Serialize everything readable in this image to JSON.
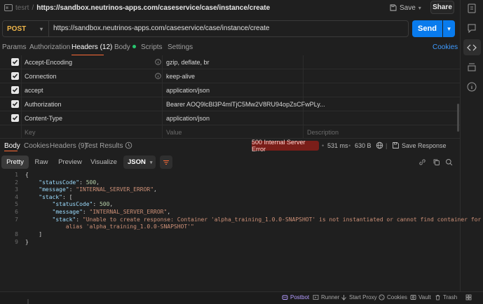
{
  "titlebar": {
    "request_name": "tesrt",
    "separator": "/",
    "url": "https://sandbox.neutrinos-apps.com/caseservice/case/instance/create",
    "save_label": "Save",
    "share_label": "Share"
  },
  "request": {
    "method": "POST",
    "url": "https://sandbox.neutrinos-apps.com/caseservice/case/instance/create",
    "send_label": "Send"
  },
  "request_tabs": {
    "params": "Params",
    "authorization": "Authorization",
    "headers": "Headers (12)",
    "body": "Body",
    "scripts": "Scripts",
    "settings": "Settings",
    "cookies": "Cookies"
  },
  "headers": {
    "rows": [
      {
        "key": "Accept-Encoding",
        "value": "gzip, deflate, br"
      },
      {
        "key": "Connection",
        "value": "keep-alive"
      },
      {
        "key": "accept",
        "value": "application/json"
      },
      {
        "key": "Authorization",
        "value": "Bearer AOQ9lcBl3P4mlTjC5Mw2V8RU94opZsCFwPLy..."
      },
      {
        "key": "Content-Type",
        "value": "application/json"
      }
    ],
    "placeholder_key": "Key",
    "placeholder_value": "Value",
    "placeholder_description": "Description"
  },
  "response_tabs": {
    "body": "Body",
    "cookies": "Cookies",
    "headers": "Headers (9)",
    "test_results": "Test Results"
  },
  "response_meta": {
    "status": "500 Internal Server Error",
    "time": "531 ms",
    "size": "630 B",
    "save_response": "Save Response"
  },
  "view": {
    "pretty": "Pretty",
    "raw": "Raw",
    "preview": "Preview",
    "visualize": "Visualize",
    "format": "JSON"
  },
  "code": {
    "line_numbers": [
      "1",
      "2",
      "3",
      "4",
      "5",
      "6",
      "7",
      "",
      "8",
      "9"
    ],
    "lines": {
      "l1": "{",
      "l2_key": "\"statusCode\"",
      "l2_num": "500",
      "l3_key": "\"message\"",
      "l3_str": "\"INTERNAL_SERVER_ERROR\"",
      "l4_key": "\"stack\"",
      "l4_rest": ": [",
      "l5_key": "\"statusCode\"",
      "l5_num": "500",
      "l6_key": "\"message\"",
      "l6_str": "\"INTERNAL_SERVER_ERROR\"",
      "l7_key": "\"stack\"",
      "l7_str": "\"Unable to create response: Container 'alpha_training_1.0.0-SNAPSHOT' is not instantiated or cannot find container for",
      "l7_cont": "alias 'alpha_training_1.0.0-SNAPSHOT'\"",
      "l8": "]",
      "l9": "}"
    }
  },
  "statusbar": {
    "postbot": "Postbot",
    "runner": "Runner",
    "start_proxy": "Start Proxy",
    "cookies": "Cookies",
    "vault": "Vault",
    "trash": "Trash"
  },
  "colors": {
    "accent": "#ff6c37",
    "send": "#097bed",
    "method_post": "#f0b64a",
    "error_badge": "#7a1e19",
    "link": "#3f9bff"
  }
}
